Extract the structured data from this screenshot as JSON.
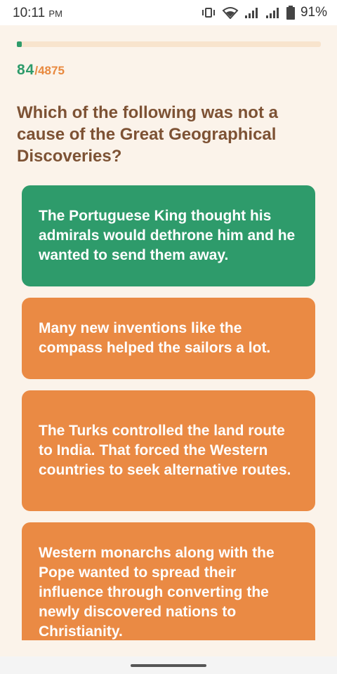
{
  "status_bar": {
    "time": "10:11",
    "ampm": "PM",
    "battery": "91%",
    "icons": [
      "vibrate-icon",
      "wifi-icon",
      "signal-icon",
      "signal-icon",
      "battery-icon"
    ]
  },
  "quiz": {
    "progress_fraction": 0.0172,
    "current": "84",
    "separator": "/",
    "total": "4875",
    "question": "Which of the following was not a cause of the Great Geographical Discoveries?",
    "answers": [
      {
        "text": "The Portuguese King thought his admirals would dethrone him and he wanted to send them away.",
        "state": "correct"
      },
      {
        "text": "Many new inventions like the compass helped the sailors a lot.",
        "state": "option"
      },
      {
        "text": "The Turks controlled the land route to India. That forced the Western countries to seek alternative routes.",
        "state": "option"
      },
      {
        "text": "Western monarchs along with the Pope wanted to spread their influence through converting the newly discovered nations to Christianity.",
        "state": "option"
      }
    ]
  },
  "colors": {
    "background": "#FBF3EA",
    "correct": "#2E9B6B",
    "option": "#EA8A44",
    "question": "#7D5234"
  }
}
